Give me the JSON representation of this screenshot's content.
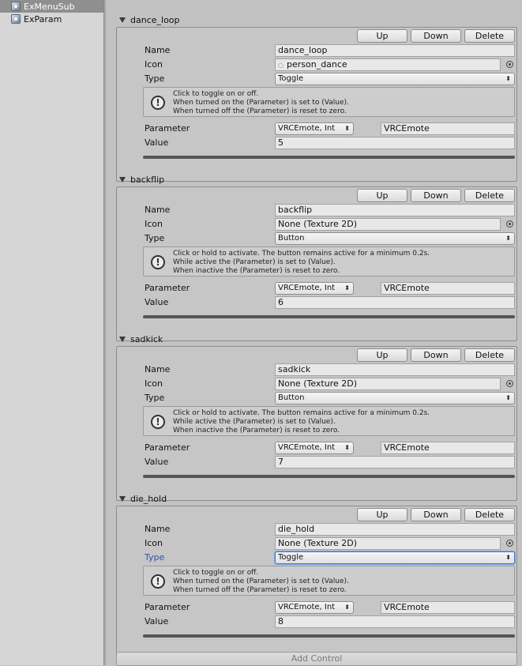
{
  "project": {
    "items": [
      {
        "label": "ExMenuSub",
        "selected": true
      },
      {
        "label": "ExParam",
        "selected": false
      }
    ]
  },
  "buttons": {
    "up": "Up",
    "down": "Down",
    "delete": "Delete"
  },
  "labels": {
    "name": "Name",
    "icon": "Icon",
    "type": "Type",
    "parameter": "Parameter",
    "value": "Value"
  },
  "controls": [
    {
      "title": "dance_loop",
      "name": "dance_loop",
      "icon": "person_dance",
      "type": "Toggle",
      "help": [
        "Click to toggle on or off.",
        "When turned on the (Parameter) is set to (Value).",
        "When turned off the (Parameter) is reset to zero."
      ],
      "parameter_type": "VRCEmote, Int",
      "parameter_name": "VRCEmote",
      "value": "5"
    },
    {
      "title": "backflip",
      "name": "backflip",
      "icon": "None (Texture 2D)",
      "type": "Button",
      "help": [
        "Click or hold to activate. The button remains active for a minimum 0.2s.",
        "While active the (Parameter) is set to (Value).",
        "When inactive the (Parameter) is reset to zero."
      ],
      "parameter_type": "VRCEmote, Int",
      "parameter_name": "VRCEmote",
      "value": "6"
    },
    {
      "title": "sadkick",
      "name": "sadkick",
      "icon": "None (Texture 2D)",
      "type": "Button",
      "help": [
        "Click or hold to activate. The button remains active for a minimum 0.2s.",
        "While active the (Parameter) is set to (Value).",
        "When inactive the (Parameter) is reset to zero."
      ],
      "parameter_type": "VRCEmote, Int",
      "parameter_name": "VRCEmote",
      "value": "7"
    },
    {
      "title": "die_hold",
      "name": "die_hold",
      "icon": "None (Texture 2D)",
      "type": "Toggle",
      "help": [
        "Click to toggle on or off.",
        "When turned on the (Parameter) is set to (Value).",
        "When turned off the (Parameter) is reset to zero."
      ],
      "parameter_type": "VRCEmote, Int",
      "parameter_name": "VRCEmote",
      "value": "8"
    }
  ],
  "add_control_label": "Add Control"
}
